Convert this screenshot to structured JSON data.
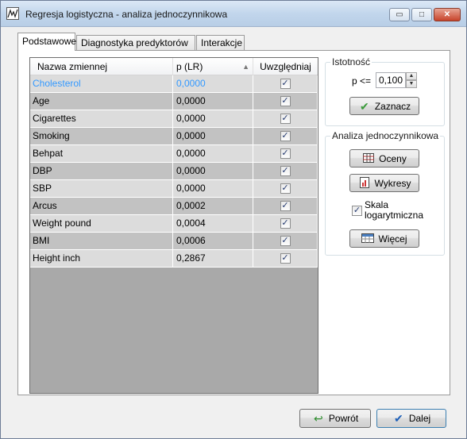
{
  "window": {
    "title": "Regresja logistyczna - analiza jednoczynnikowa"
  },
  "window_buttons": {
    "minimize": "▭",
    "maximize": "□",
    "close": "✕"
  },
  "tabs": [
    {
      "label": "Podstawowe",
      "active": true
    },
    {
      "label": "Diagnostyka predyktorów",
      "active": false
    },
    {
      "label": "Interakcje",
      "active": false
    }
  ],
  "grid": {
    "headers": {
      "name": "Nazwa zmiennej",
      "p": "p (LR)",
      "include": "Uwzględniaj"
    },
    "sort_icon": "sort-up-icon",
    "rows": [
      {
        "name": "Cholesterol",
        "p": "0,0000",
        "checked": true,
        "selected": true
      },
      {
        "name": "Age",
        "p": "0,0000",
        "checked": true
      },
      {
        "name": "Cigarettes",
        "p": "0,0000",
        "checked": true
      },
      {
        "name": "Smoking",
        "p": "0,0000",
        "checked": true
      },
      {
        "name": "Behpat",
        "p": "0,0000",
        "checked": true
      },
      {
        "name": "DBP",
        "p": "0,0000",
        "checked": true
      },
      {
        "name": "SBP",
        "p": "0,0000",
        "checked": true
      },
      {
        "name": "Arcus",
        "p": "0,0002",
        "checked": true
      },
      {
        "name": "Weight pound",
        "p": "0,0004",
        "checked": true
      },
      {
        "name": "BMI",
        "p": "0,0006",
        "checked": true
      },
      {
        "name": "Height inch",
        "p": "0,2867",
        "checked": true
      }
    ]
  },
  "significance": {
    "title": "Istotność",
    "p_label": "p <=",
    "p_value": "0,100",
    "select_button": "Zaznacz"
  },
  "univariate": {
    "title": "Analiza jednoczynnikowa",
    "estimates_button": "Oceny",
    "charts_button": "Wykresy",
    "log_scale_label_line1": "Skala",
    "log_scale_label_line2": "logarytmiczna",
    "log_scale_checked": true,
    "more_button": "Więcej"
  },
  "footer": {
    "back_button": "Powrót",
    "next_button": "Dalej"
  },
  "colors": {
    "selected_text": "#3399ff",
    "row_light": "#dcdcdc",
    "row_dark": "#c2c2c2"
  }
}
